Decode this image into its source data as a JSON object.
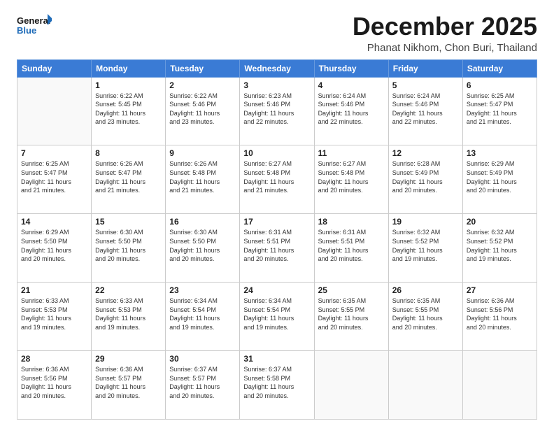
{
  "logo": {
    "line1": "General",
    "line2": "Blue"
  },
  "title": "December 2025",
  "subtitle": "Phanat Nikhom, Chon Buri, Thailand",
  "weekdays": [
    "Sunday",
    "Monday",
    "Tuesday",
    "Wednesday",
    "Thursday",
    "Friday",
    "Saturday"
  ],
  "weeks": [
    [
      {
        "day": "",
        "info": ""
      },
      {
        "day": "1",
        "info": "Sunrise: 6:22 AM\nSunset: 5:45 PM\nDaylight: 11 hours\nand 23 minutes."
      },
      {
        "day": "2",
        "info": "Sunrise: 6:22 AM\nSunset: 5:46 PM\nDaylight: 11 hours\nand 23 minutes."
      },
      {
        "day": "3",
        "info": "Sunrise: 6:23 AM\nSunset: 5:46 PM\nDaylight: 11 hours\nand 22 minutes."
      },
      {
        "day": "4",
        "info": "Sunrise: 6:24 AM\nSunset: 5:46 PM\nDaylight: 11 hours\nand 22 minutes."
      },
      {
        "day": "5",
        "info": "Sunrise: 6:24 AM\nSunset: 5:46 PM\nDaylight: 11 hours\nand 22 minutes."
      },
      {
        "day": "6",
        "info": "Sunrise: 6:25 AM\nSunset: 5:47 PM\nDaylight: 11 hours\nand 21 minutes."
      }
    ],
    [
      {
        "day": "7",
        "info": "Sunrise: 6:25 AM\nSunset: 5:47 PM\nDaylight: 11 hours\nand 21 minutes."
      },
      {
        "day": "8",
        "info": "Sunrise: 6:26 AM\nSunset: 5:47 PM\nDaylight: 11 hours\nand 21 minutes."
      },
      {
        "day": "9",
        "info": "Sunrise: 6:26 AM\nSunset: 5:48 PM\nDaylight: 11 hours\nand 21 minutes."
      },
      {
        "day": "10",
        "info": "Sunrise: 6:27 AM\nSunset: 5:48 PM\nDaylight: 11 hours\nand 21 minutes."
      },
      {
        "day": "11",
        "info": "Sunrise: 6:27 AM\nSunset: 5:48 PM\nDaylight: 11 hours\nand 20 minutes."
      },
      {
        "day": "12",
        "info": "Sunrise: 6:28 AM\nSunset: 5:49 PM\nDaylight: 11 hours\nand 20 minutes."
      },
      {
        "day": "13",
        "info": "Sunrise: 6:29 AM\nSunset: 5:49 PM\nDaylight: 11 hours\nand 20 minutes."
      }
    ],
    [
      {
        "day": "14",
        "info": "Sunrise: 6:29 AM\nSunset: 5:50 PM\nDaylight: 11 hours\nand 20 minutes."
      },
      {
        "day": "15",
        "info": "Sunrise: 6:30 AM\nSunset: 5:50 PM\nDaylight: 11 hours\nand 20 minutes."
      },
      {
        "day": "16",
        "info": "Sunrise: 6:30 AM\nSunset: 5:50 PM\nDaylight: 11 hours\nand 20 minutes."
      },
      {
        "day": "17",
        "info": "Sunrise: 6:31 AM\nSunset: 5:51 PM\nDaylight: 11 hours\nand 20 minutes."
      },
      {
        "day": "18",
        "info": "Sunrise: 6:31 AM\nSunset: 5:51 PM\nDaylight: 11 hours\nand 20 minutes."
      },
      {
        "day": "19",
        "info": "Sunrise: 6:32 AM\nSunset: 5:52 PM\nDaylight: 11 hours\nand 19 minutes."
      },
      {
        "day": "20",
        "info": "Sunrise: 6:32 AM\nSunset: 5:52 PM\nDaylight: 11 hours\nand 19 minutes."
      }
    ],
    [
      {
        "day": "21",
        "info": "Sunrise: 6:33 AM\nSunset: 5:53 PM\nDaylight: 11 hours\nand 19 minutes."
      },
      {
        "day": "22",
        "info": "Sunrise: 6:33 AM\nSunset: 5:53 PM\nDaylight: 11 hours\nand 19 minutes."
      },
      {
        "day": "23",
        "info": "Sunrise: 6:34 AM\nSunset: 5:54 PM\nDaylight: 11 hours\nand 19 minutes."
      },
      {
        "day": "24",
        "info": "Sunrise: 6:34 AM\nSunset: 5:54 PM\nDaylight: 11 hours\nand 19 minutes."
      },
      {
        "day": "25",
        "info": "Sunrise: 6:35 AM\nSunset: 5:55 PM\nDaylight: 11 hours\nand 20 minutes."
      },
      {
        "day": "26",
        "info": "Sunrise: 6:35 AM\nSunset: 5:55 PM\nDaylight: 11 hours\nand 20 minutes."
      },
      {
        "day": "27",
        "info": "Sunrise: 6:36 AM\nSunset: 5:56 PM\nDaylight: 11 hours\nand 20 minutes."
      }
    ],
    [
      {
        "day": "28",
        "info": "Sunrise: 6:36 AM\nSunset: 5:56 PM\nDaylight: 11 hours\nand 20 minutes."
      },
      {
        "day": "29",
        "info": "Sunrise: 6:36 AM\nSunset: 5:57 PM\nDaylight: 11 hours\nand 20 minutes."
      },
      {
        "day": "30",
        "info": "Sunrise: 6:37 AM\nSunset: 5:57 PM\nDaylight: 11 hours\nand 20 minutes."
      },
      {
        "day": "31",
        "info": "Sunrise: 6:37 AM\nSunset: 5:58 PM\nDaylight: 11 hours\nand 20 minutes."
      },
      {
        "day": "",
        "info": ""
      },
      {
        "day": "",
        "info": ""
      },
      {
        "day": "",
        "info": ""
      }
    ]
  ]
}
